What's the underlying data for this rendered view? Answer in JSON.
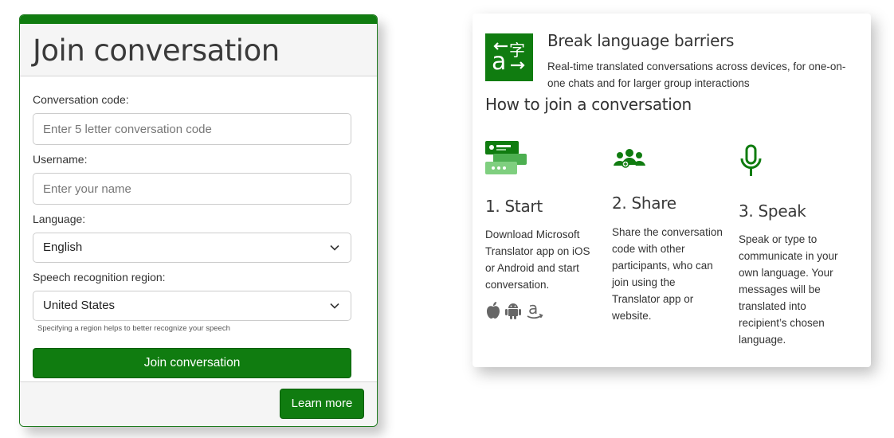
{
  "join_form": {
    "title": "Join conversation",
    "conversation_code": {
      "label": "Conversation code:",
      "placeholder": "Enter 5 letter conversation code",
      "value": ""
    },
    "username": {
      "label": "Username:",
      "placeholder": "Enter your name",
      "value": ""
    },
    "language": {
      "label": "Language:",
      "selected": "English"
    },
    "region": {
      "label": "Speech recognition region:",
      "selected": "United States",
      "hint": "Specifying a region helps to better recognize your speech"
    },
    "join_button": "Join conversation",
    "learn_more_button": "Learn more",
    "accent_color": "#107c10"
  },
  "info": {
    "title": "Break language barriers",
    "description": "Real-time translated conversations across devices, for one-on-one chats and for larger group interactions",
    "howto_title": "How to join a conversation",
    "logo_icon": "translator-logo-icon",
    "steps": [
      {
        "title": "1. Start",
        "text": "Download Microsoft Translator app on iOS or Android and start conversation.",
        "icon": "chat-devices-icon",
        "platforms": [
          "apple-icon",
          "android-icon",
          "amazon-icon"
        ]
      },
      {
        "title": "2. Share",
        "text": "Share the conversation code with other participants, who can join using the Translator app or website.",
        "icon": "people-group-icon"
      },
      {
        "title": "3. Speak",
        "text": "Speak or type to communicate in your own language. Your messages will be translated into recipient’s chosen language.",
        "icon": "microphone-icon"
      }
    ]
  }
}
